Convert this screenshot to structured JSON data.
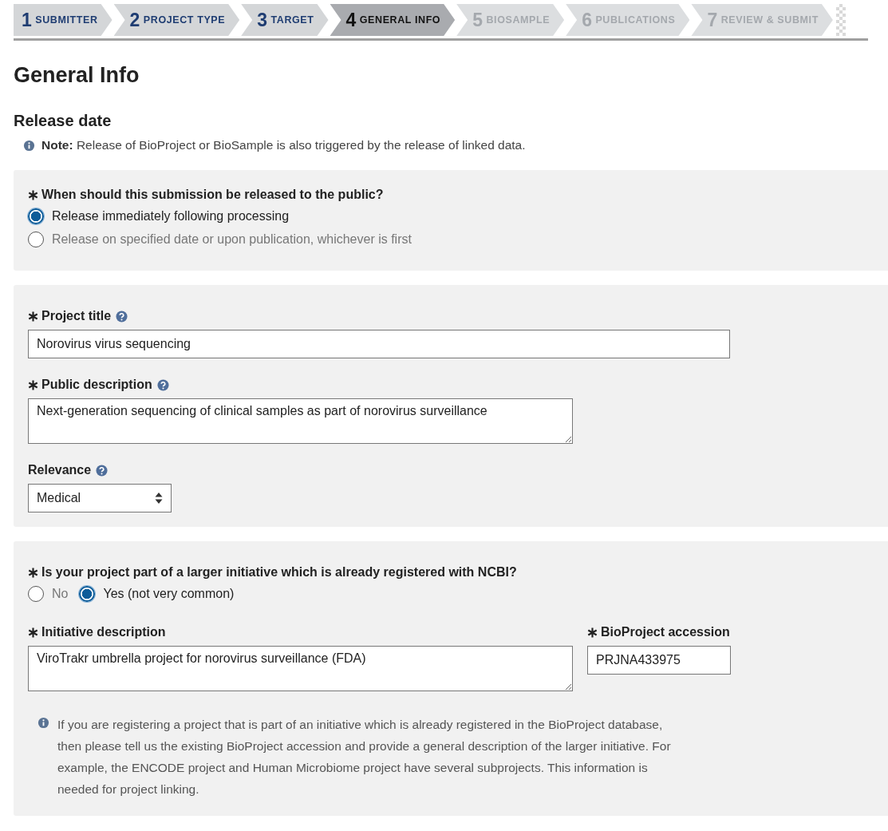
{
  "steps": [
    {
      "number": "1",
      "label": "SUBMITTER",
      "selected": false,
      "disabled": false
    },
    {
      "number": "2",
      "label": "PROJECT TYPE",
      "selected": false,
      "disabled": false
    },
    {
      "number": "3",
      "label": "TARGET",
      "selected": false,
      "disabled": false
    },
    {
      "number": "4",
      "label": "GENERAL INFO",
      "selected": true,
      "disabled": false
    },
    {
      "number": "5",
      "label": "BIOSAMPLE",
      "selected": false,
      "disabled": true
    },
    {
      "number": "6",
      "label": "PUBLICATIONS",
      "selected": false,
      "disabled": true
    },
    {
      "number": "7",
      "label": "REVIEW & SUBMIT",
      "selected": false,
      "disabled": true
    }
  ],
  "heading": "General Info",
  "release": {
    "title": "Release date",
    "note": "**Note:** Release of BioProject or BioSample is also triggered by the release of linked data.",
    "question": {
      "label": "When should this submission be released to the public?",
      "required": true
    },
    "options": [
      {
        "label": "Release immediately following processing",
        "selected": true
      },
      {
        "label": "Release on specified date or upon publication, whichever is first",
        "selected": false
      }
    ]
  },
  "project": {
    "fields": [
      {
        "kind": "input",
        "label": "Project title",
        "required": true,
        "help": true,
        "value": "Norovirus virus sequencing"
      },
      {
        "kind": "textarea",
        "label": "Public description",
        "required": true,
        "help": true,
        "value": "Next-generation sequencing of clinical samples as part of norovirus surveillance"
      },
      {
        "kind": "select",
        "label": "Relevance",
        "required": false,
        "help": true,
        "value": "Medical"
      }
    ]
  },
  "initiative": {
    "question": {
      "label": "Is your project part of a larger initiative which is already registered with NCBI?",
      "required": true
    },
    "options": [
      {
        "label": "No",
        "selected": false
      },
      {
        "label": "Yes (not very common)",
        "selected": true
      }
    ],
    "description": {
      "label": "Initiative description",
      "required": true,
      "value": "ViroTrakr umbrella project for norovirus surveillance (FDA)"
    },
    "accession": {
      "label": "BioProject accession",
      "required": true,
      "value": "PRJNA433975"
    },
    "info": "If you are registering a project that is part of an initiative which is already registered in the BioProject database, then please tell us the existing BioProject accession and provide a general description of the larger initiative. For example, the ENCODE project and Human Microbiome project have several subprojects. This information is needed for project linking."
  }
}
